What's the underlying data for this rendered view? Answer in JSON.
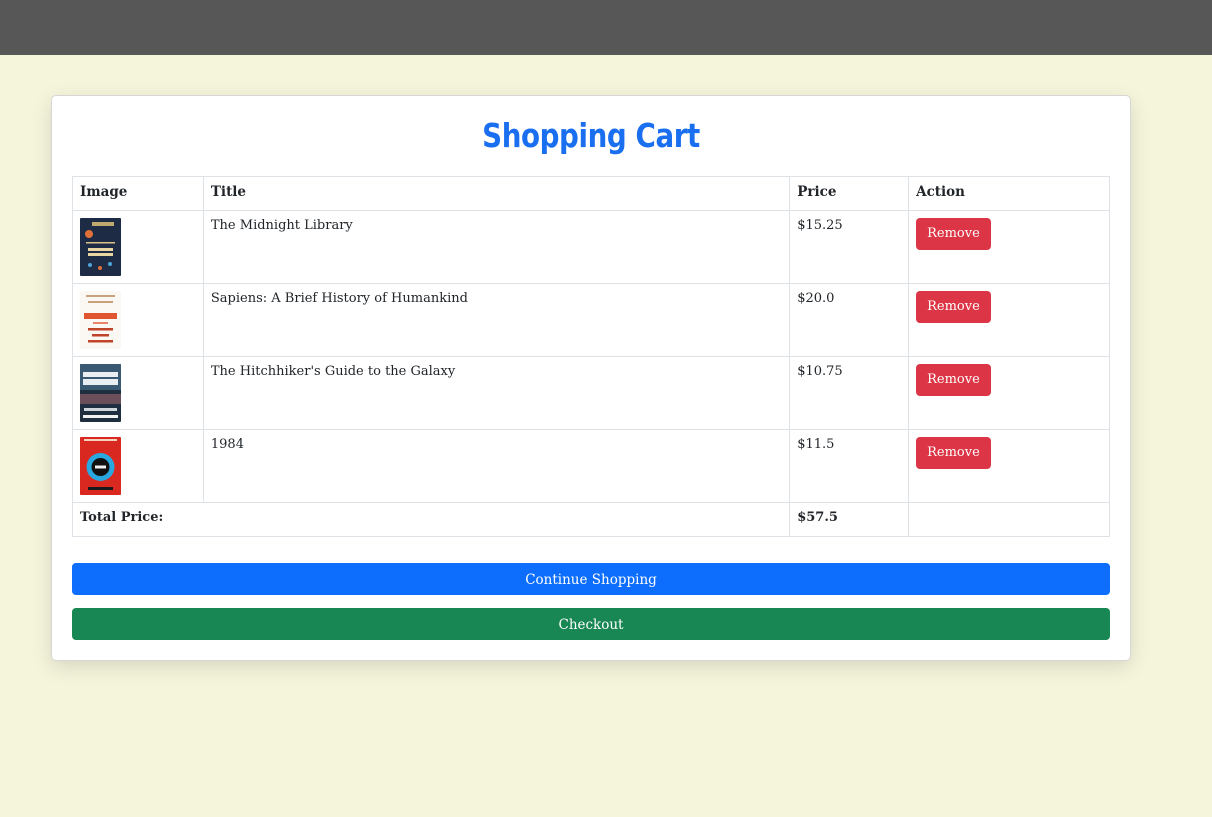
{
  "page": {
    "title": "Shopping Cart",
    "colors": {
      "background": "#f5f5dc",
      "topbar": "#575757",
      "title": "#1a6ff0",
      "remove_button": "#dc3545",
      "continue_button": "#0d6efd",
      "checkout_button": "#198754"
    }
  },
  "table": {
    "headers": {
      "image": "Image",
      "title": "Title",
      "price": "Price",
      "action": "Action"
    },
    "items": [
      {
        "title": "The Midnight Library",
        "price": "$15.25",
        "action_label": "Remove",
        "cover_icon": "book-cover-midnight-library"
      },
      {
        "title": "Sapiens: A Brief History of Humankind",
        "price": "$20.0",
        "action_label": "Remove",
        "cover_icon": "book-cover-sapiens"
      },
      {
        "title": "The Hitchhiker's Guide to the Galaxy",
        "price": "$10.75",
        "action_label": "Remove",
        "cover_icon": "book-cover-hitchhiker"
      },
      {
        "title": "1984",
        "price": "$11.5",
        "action_label": "Remove",
        "cover_icon": "book-cover-1984"
      }
    ],
    "total_label": "Total Price:",
    "total_value": "$57.5"
  },
  "actions": {
    "continue_label": "Continue Shopping",
    "checkout_label": "Checkout"
  }
}
